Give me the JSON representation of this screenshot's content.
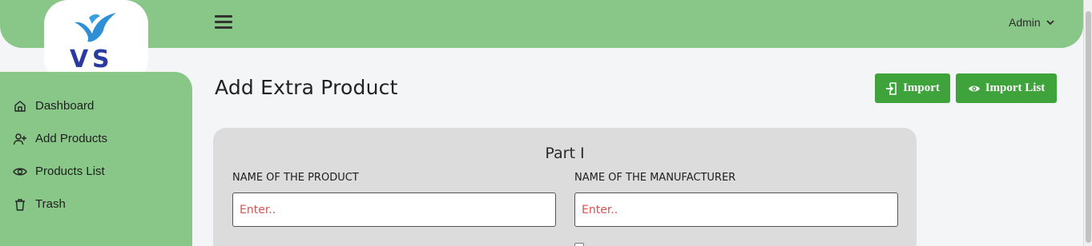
{
  "header": {
    "admin_label": "Admin"
  },
  "sidebar": {
    "items": [
      {
        "label": "Dashboard",
        "icon": "home-icon"
      },
      {
        "label": "Add Products",
        "icon": "add-user-icon"
      },
      {
        "label": "Products List",
        "icon": "eye-icon"
      },
      {
        "label": "Trash",
        "icon": "trash-icon"
      }
    ]
  },
  "main": {
    "title": "Add Extra Product",
    "buttons": {
      "import_label": "Import",
      "import_list_label": "Import List"
    },
    "form": {
      "part_title": "Part I",
      "product_name_label": "NAME OF THE PRODUCT",
      "product_name_placeholder": "Enter..",
      "manufacturer_label": "NAME OF THE MANUFACTURER",
      "manufacturer_placeholder": "Enter.."
    }
  },
  "colors": {
    "brand_green": "#88c788",
    "button_green": "#3da33a",
    "placeholder_red": "#d9534f"
  }
}
